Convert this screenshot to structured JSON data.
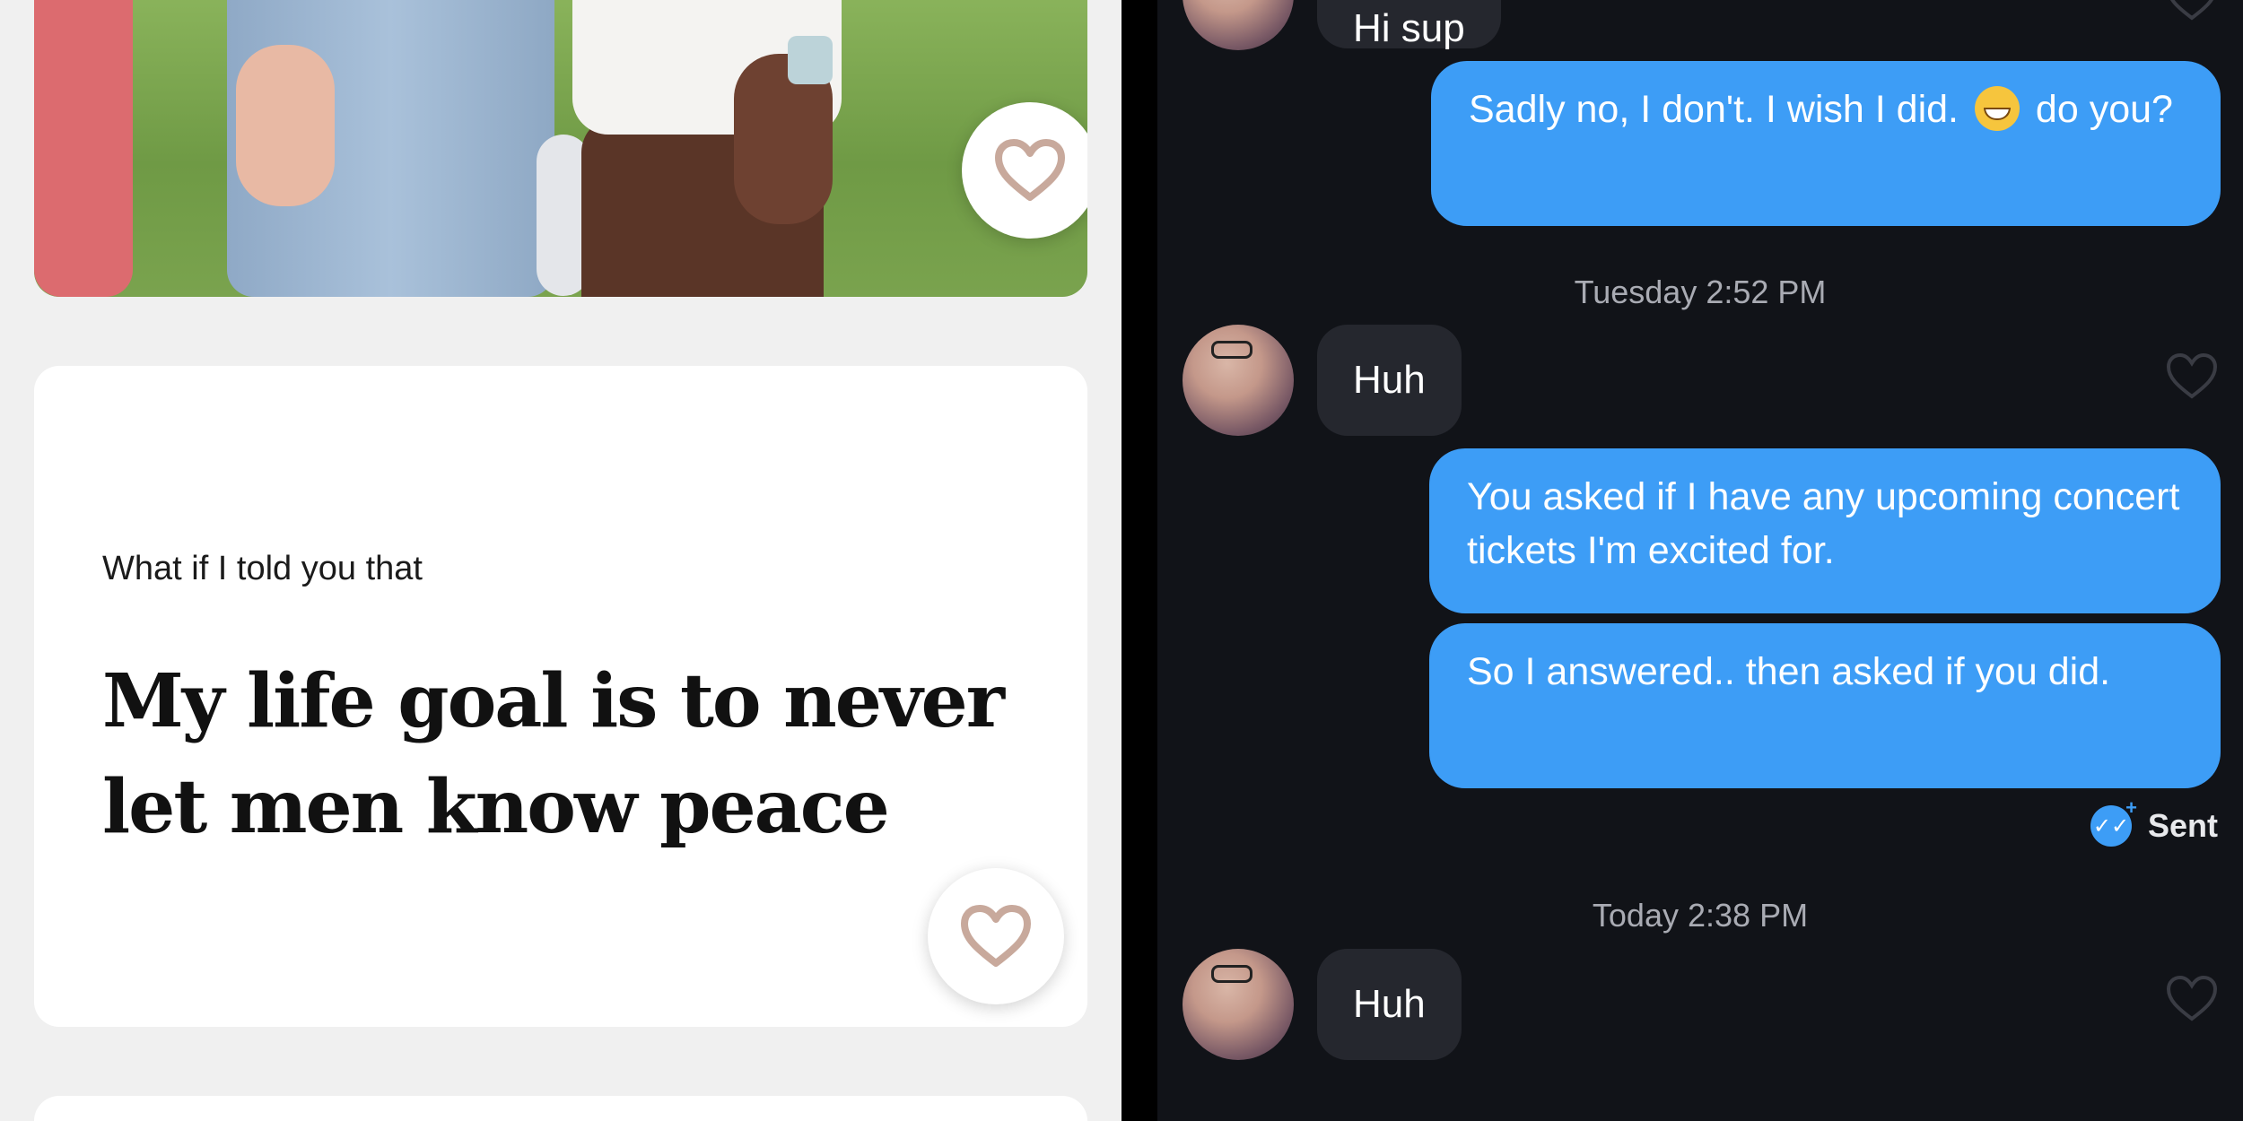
{
  "profile": {
    "prompt_question": "What if I told you that",
    "prompt_answer": "My life goal is to never let men know peace"
  },
  "chat": {
    "messages": [
      {
        "direction": "in",
        "text": "Hi sup"
      },
      {
        "direction": "out",
        "text_before_emoji": "Sadly no, I don't. I wish I did.",
        "emoji": "grinning-sweat-emoji",
        "text_after_emoji": "do you?"
      },
      {
        "direction": "in",
        "text": "Huh"
      },
      {
        "direction": "out",
        "text": "You asked if I have any upcoming concert tickets I'm excited for."
      },
      {
        "direction": "out",
        "text": "So I answered.. then asked if you did."
      },
      {
        "direction": "in",
        "text": "Huh"
      }
    ],
    "timestamps": [
      {
        "day": "Tuesday",
        "time": "2:52 PM"
      },
      {
        "day": "Today",
        "time": "2:38 PM"
      }
    ],
    "status": "Sent"
  },
  "colors": {
    "chat_background": "#111318",
    "incoming_bubble": "#25272e",
    "outgoing_bubble": "#3d9df6",
    "heart_stroke_profile": "#c8a99c",
    "heart_stroke_chat": "#3a3c44"
  },
  "icons": [
    "heart-outline-icon",
    "double-check-icon"
  ]
}
